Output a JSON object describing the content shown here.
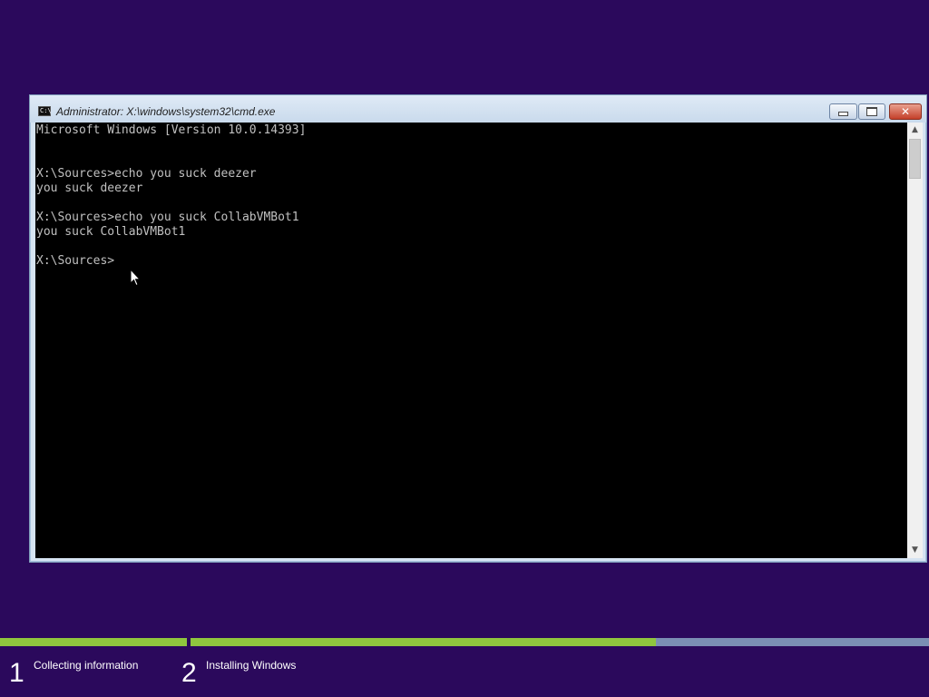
{
  "window": {
    "title": "Administrator: X:\\windows\\system32\\cmd.exe",
    "icon": "cmd-icon",
    "icon_text": "C:\\",
    "minimize_icon": "minimize-icon",
    "maximize_icon": "maximize-icon",
    "close_icon": "close-icon",
    "close_glyph": "✕"
  },
  "console": {
    "lines": [
      "Microsoft Windows [Version 10.0.14393]",
      "",
      "",
      "X:\\Sources>echo you suck deezer",
      "you suck deezer",
      "",
      "X:\\Sources>echo you suck CollabVMBot1",
      "you suck CollabVMBot1",
      "",
      "X:\\Sources>"
    ]
  },
  "scrollbar": {
    "up_glyph": "▲",
    "down_glyph": "▼"
  },
  "setup": {
    "progress": [
      {
        "fraction": 1.0
      },
      {
        "fraction": 0.63
      }
    ],
    "steps": [
      {
        "number": "1",
        "label": "Collecting information"
      },
      {
        "number": "2",
        "label": "Installing Windows"
      }
    ]
  },
  "colors": {
    "desktop_bg": "#2b095c",
    "console_bg": "#000000",
    "console_text": "#c0c0c0",
    "progress_done": "#8fc63e",
    "progress_remaining": "#7b8fb4"
  }
}
